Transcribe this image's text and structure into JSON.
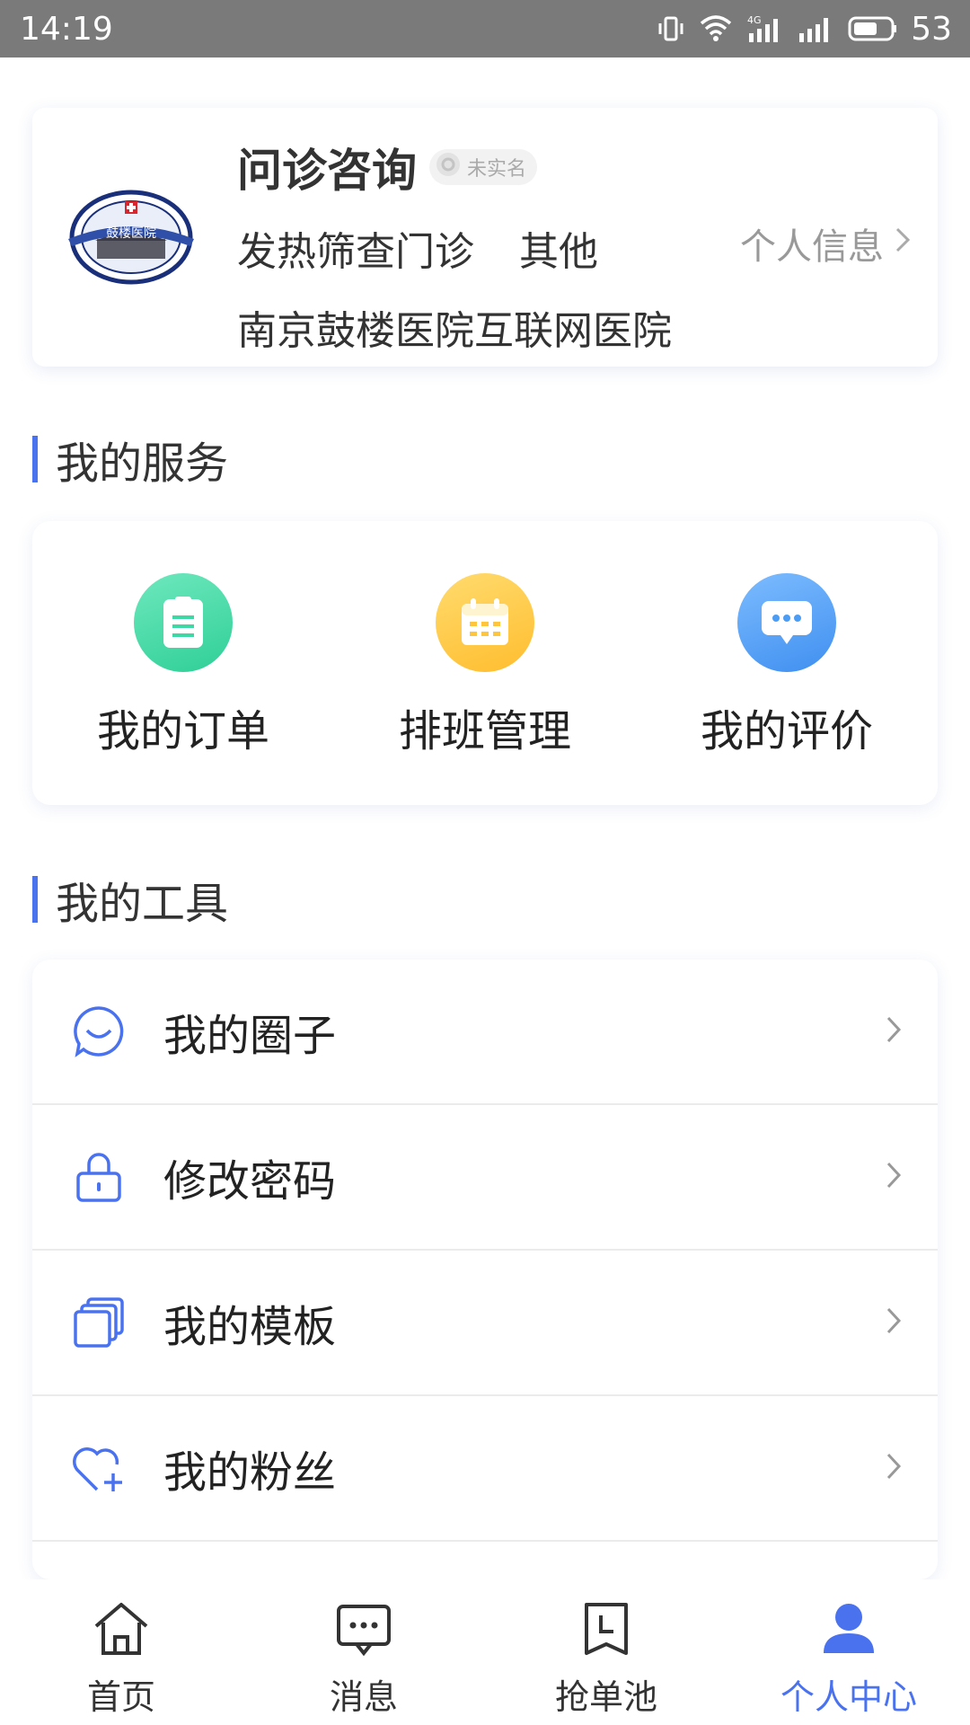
{
  "status_bar": {
    "time": "14:19",
    "network": "4G",
    "battery": "53"
  },
  "profile": {
    "name": "问诊咨询",
    "verify_status": "未实名",
    "department": "发热筛查门诊",
    "title": "其他",
    "hospital": "南京鼓楼医院互联网医院",
    "personal_info_link": "个人信息",
    "logo_text": "鼓楼医院"
  },
  "services": {
    "title": "我的服务",
    "items": [
      {
        "label": "我的订单",
        "icon": "clipboard-icon",
        "color": "#3ed8a4"
      },
      {
        "label": "排班管理",
        "icon": "calendar-icon",
        "color": "#ffc53d"
      },
      {
        "label": "我的评价",
        "icon": "chat-bubble-icon",
        "color": "#4a9cf5"
      }
    ]
  },
  "tools": {
    "title": "我的工具",
    "items": [
      {
        "label": "我的圈子",
        "icon": "circle-chat-icon"
      },
      {
        "label": "修改密码",
        "icon": "lock-icon"
      },
      {
        "label": "我的模板",
        "icon": "template-stack-icon"
      },
      {
        "label": "我的粉丝",
        "icon": "heart-plus-icon"
      }
    ]
  },
  "tabbar": {
    "active_color": "#4a72ef",
    "items": [
      {
        "label": "首页",
        "icon": "home-icon"
      },
      {
        "label": "消息",
        "icon": "message-icon"
      },
      {
        "label": "抢单池",
        "icon": "order-pool-icon"
      },
      {
        "label": "个人中心",
        "icon": "person-icon",
        "active": true
      }
    ]
  }
}
